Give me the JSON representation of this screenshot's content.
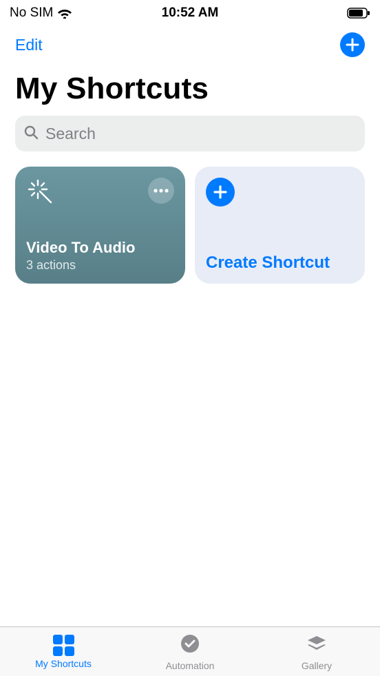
{
  "status": {
    "carrier": "No SIM",
    "time": "10:52 AM"
  },
  "nav": {
    "edit_label": "Edit"
  },
  "title": "My Shortcuts",
  "search": {
    "placeholder": "Search"
  },
  "shortcut_card": {
    "name": "Video To Audio",
    "subtitle": "3 actions"
  },
  "create_card": {
    "label": "Create Shortcut"
  },
  "tabs": {
    "shortcuts": "My Shortcuts",
    "automation": "Automation",
    "gallery": "Gallery"
  },
  "colors": {
    "accent": "#007aff",
    "card_shortcut": "#5e8993",
    "card_create_bg": "#e8ecf7",
    "icon_inactive": "#8e8e93"
  }
}
